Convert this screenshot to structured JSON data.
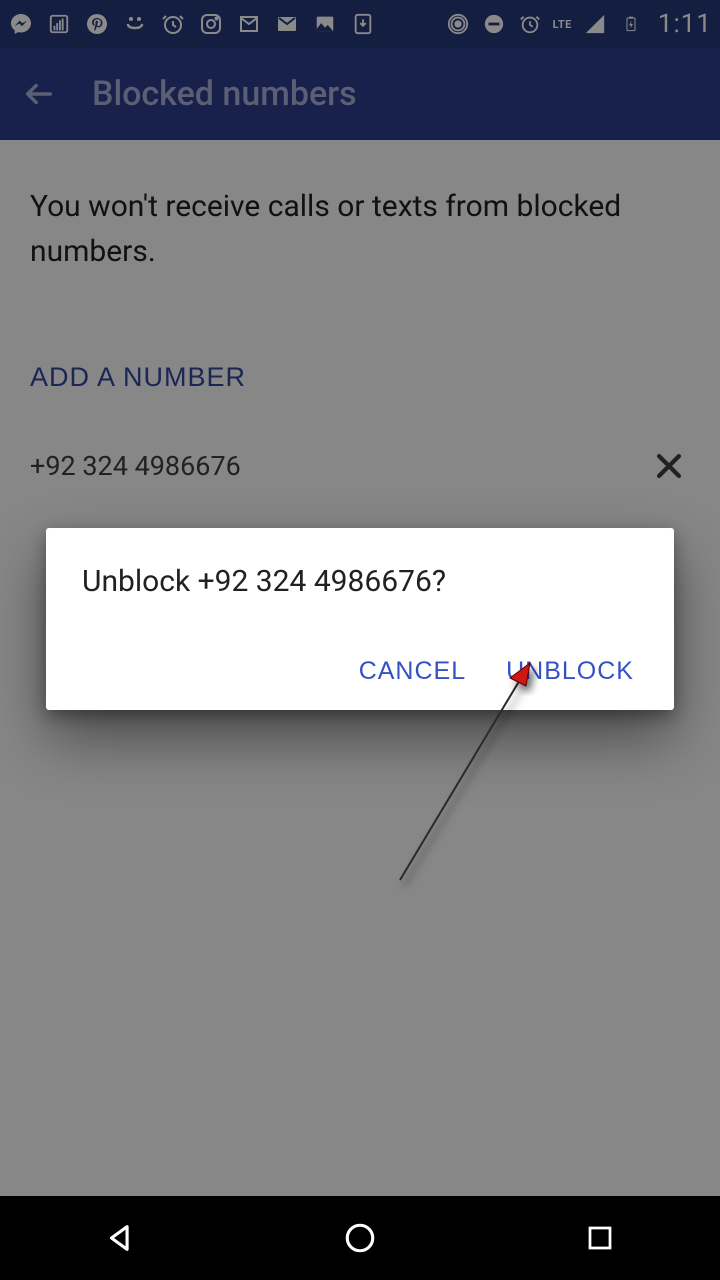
{
  "status": {
    "time": "1:11",
    "lte": "LTE"
  },
  "appbar": {
    "title": "Blocked numbers"
  },
  "content": {
    "description": "You won't receive calls or texts from blocked numbers.",
    "add_label": "ADD A NUMBER",
    "numbers": [
      {
        "value": "+92 324 4986676"
      }
    ]
  },
  "dialog": {
    "title": "Unblock +92 324 4986676?",
    "cancel": "CANCEL",
    "confirm": "UNBLOCK"
  }
}
